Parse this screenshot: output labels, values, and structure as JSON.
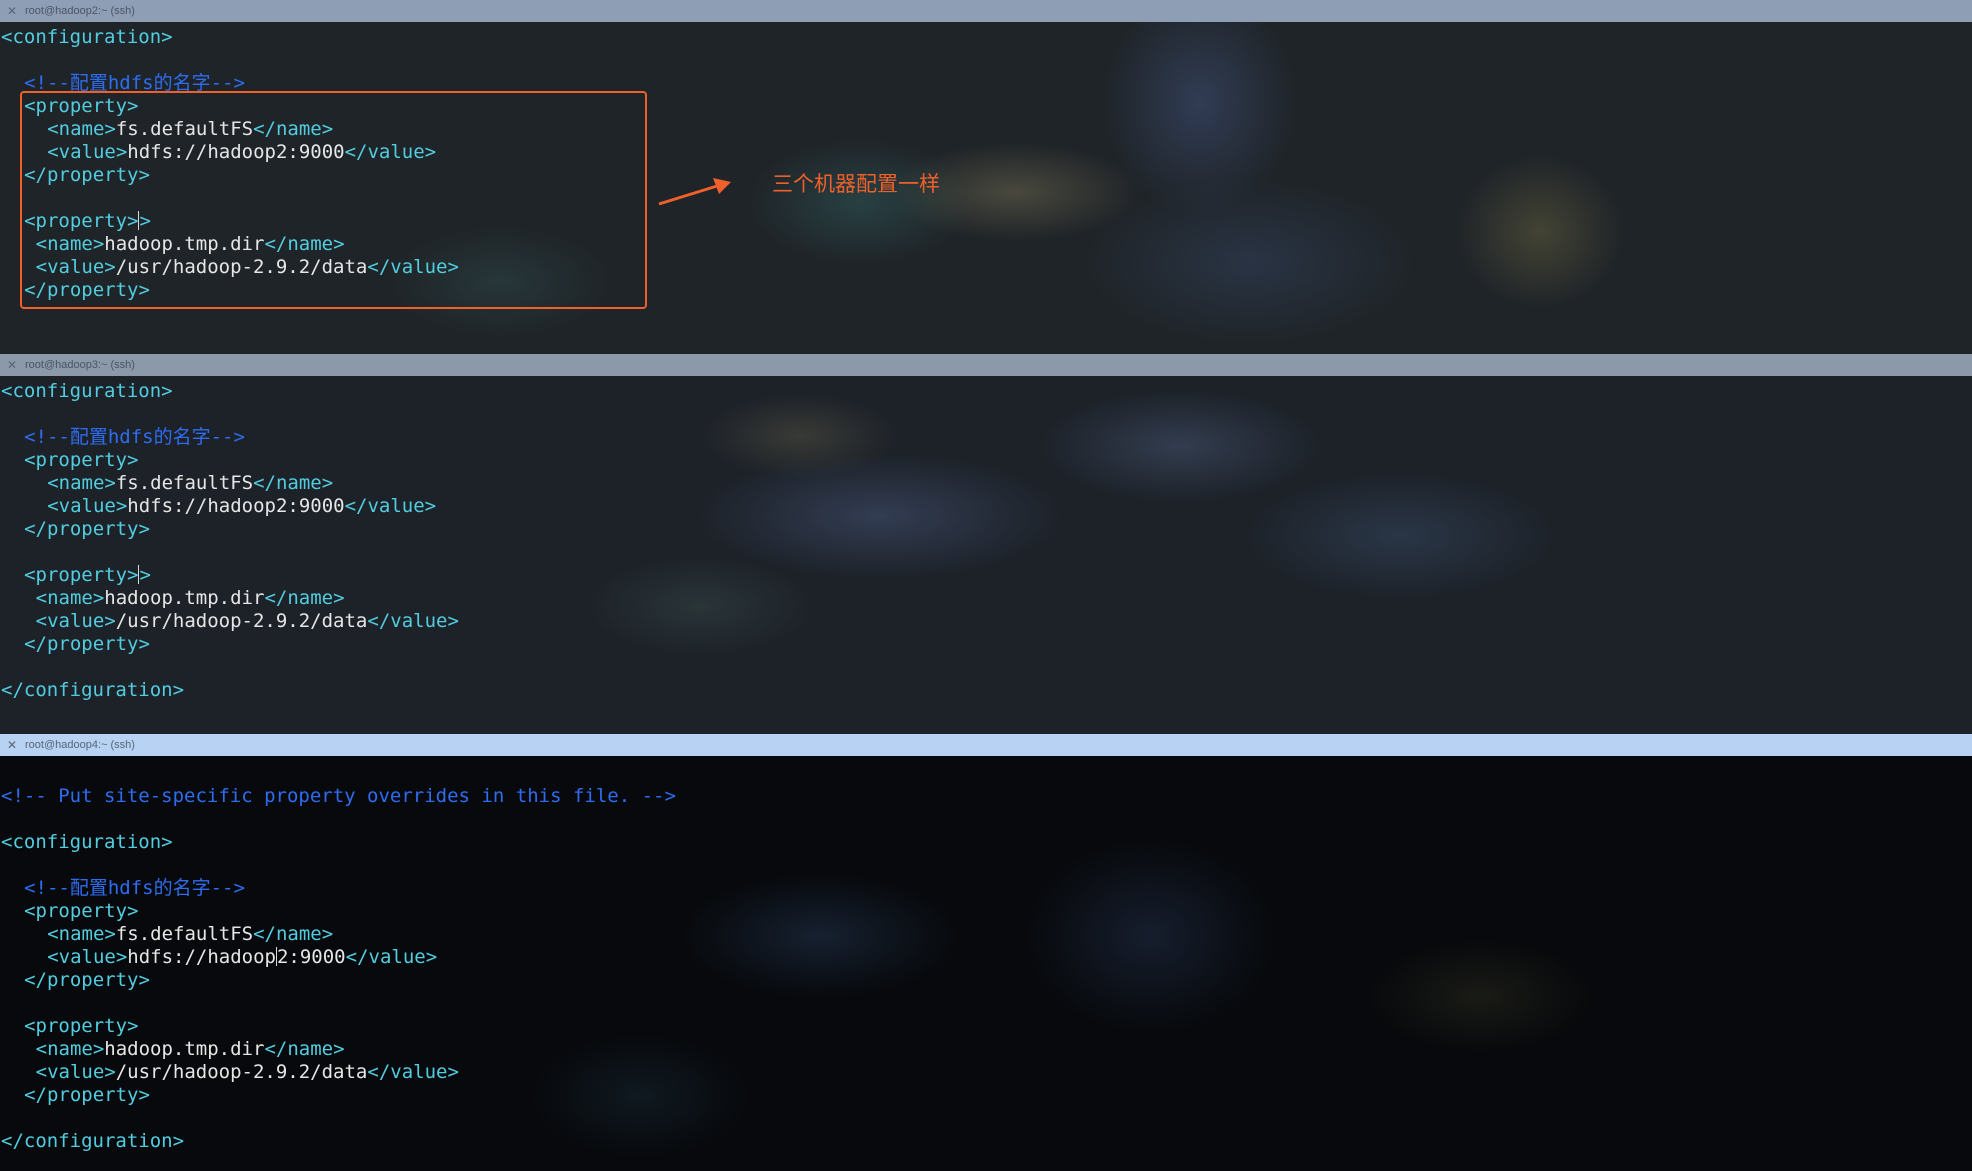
{
  "panes": [
    {
      "title": "root@hadoop2:~ (ssh)",
      "lines": [
        {
          "type": "tag",
          "text": "<configuration>"
        },
        {
          "type": "blank"
        },
        {
          "type": "comment",
          "indent": 2,
          "text": "<!--配置hdfs的名字-->"
        },
        {
          "type": "tag",
          "indent": 2,
          "text": "<property>"
        },
        {
          "type": "element",
          "indent": 4,
          "open": "<name>",
          "value": "fs.defaultFS",
          "close": "</name>"
        },
        {
          "type": "element",
          "indent": 4,
          "open": "<value>",
          "value": "hdfs://hadoop2:9000",
          "close": "</value>"
        },
        {
          "type": "tag",
          "indent": 2,
          "text": "</property>"
        },
        {
          "type": "blank"
        },
        {
          "type": "tag",
          "indent": 2,
          "text": "<property>",
          "cursor_after": 10
        },
        {
          "type": "element",
          "indent": 3,
          "open": "<name>",
          "value": "hadoop.tmp.dir",
          "close": "</name>"
        },
        {
          "type": "element",
          "indent": 3,
          "open": "<value>",
          "value": "/usr/hadoop-2.9.2/data",
          "close": "</value>"
        },
        {
          "type": "tag",
          "indent": 2,
          "text": "</property>"
        }
      ]
    },
    {
      "title": "root@hadoop3:~ (ssh)",
      "lines": [
        {
          "type": "tag",
          "text": "<configuration>"
        },
        {
          "type": "blank"
        },
        {
          "type": "comment",
          "indent": 2,
          "text": "<!--配置hdfs的名字-->"
        },
        {
          "type": "tag",
          "indent": 2,
          "text": "<property>"
        },
        {
          "type": "element",
          "indent": 4,
          "open": "<name>",
          "value": "fs.defaultFS",
          "close": "</name>"
        },
        {
          "type": "element",
          "indent": 4,
          "open": "<value>",
          "value": "hdfs://hadoop2:9000",
          "close": "</value>"
        },
        {
          "type": "tag",
          "indent": 2,
          "text": "</property>"
        },
        {
          "type": "blank"
        },
        {
          "type": "tag",
          "indent": 2,
          "text": "<property>",
          "cursor_after": 10
        },
        {
          "type": "element",
          "indent": 3,
          "open": "<name>",
          "value": "hadoop.tmp.dir",
          "close": "</name>"
        },
        {
          "type": "element",
          "indent": 3,
          "open": "<value>",
          "value": "/usr/hadoop-2.9.2/data",
          "close": "</value>"
        },
        {
          "type": "tag",
          "indent": 2,
          "text": "</property>"
        },
        {
          "type": "blank"
        },
        {
          "type": "tag",
          "text": "</configuration>"
        }
      ]
    },
    {
      "title": "root@hadoop4:~ (ssh)",
      "lines": [
        {
          "type": "blank"
        },
        {
          "type": "comment",
          "text": "<!-- Put site-specific property overrides in this file. -->"
        },
        {
          "type": "blank"
        },
        {
          "type": "tag",
          "text": "<configuration>"
        },
        {
          "type": "blank"
        },
        {
          "type": "comment",
          "indent": 2,
          "text": "<!--配置hdfs的名字-->"
        },
        {
          "type": "tag",
          "indent": 2,
          "text": "<property>"
        },
        {
          "type": "element",
          "indent": 4,
          "open": "<name>",
          "value": "fs.defaultFS",
          "close": "</name>"
        },
        {
          "type": "element",
          "indent": 4,
          "open": "<value>",
          "value": "hdfs://hadoop2:9000",
          "close": "</value>",
          "cursor_in_value": 13
        },
        {
          "type": "tag",
          "indent": 2,
          "text": "</property>"
        },
        {
          "type": "blank"
        },
        {
          "type": "tag",
          "indent": 2,
          "text": "<property>"
        },
        {
          "type": "element",
          "indent": 3,
          "open": "<name>",
          "value": "hadoop.tmp.dir",
          "close": "</name>"
        },
        {
          "type": "element",
          "indent": 3,
          "open": "<value>",
          "value": "/usr/hadoop-2.9.2/data",
          "close": "</value>"
        },
        {
          "type": "tag",
          "indent": 2,
          "text": "</property>"
        },
        {
          "type": "blank"
        },
        {
          "type": "tag",
          "text": "</configuration>"
        }
      ]
    }
  ],
  "annotation": {
    "text": "三个机器配置一样",
    "color": "#f0602a"
  },
  "colors": {
    "tag": "#52cde0",
    "text": "#e6e6e6",
    "comment": "#2e6cf0"
  }
}
